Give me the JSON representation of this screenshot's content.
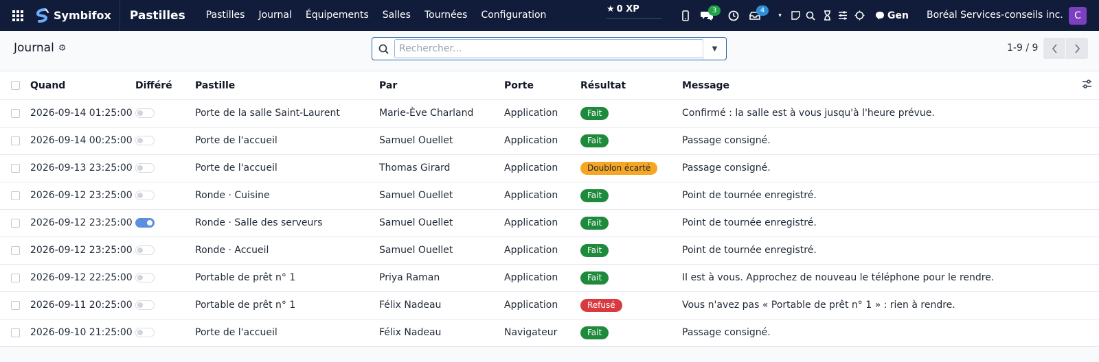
{
  "navbar": {
    "logo_text": "Symbifox",
    "app_title": "Pastilles",
    "menu": [
      "Pastilles",
      "Journal",
      "Équipements",
      "Salles",
      "Tournées",
      "Configuration"
    ],
    "xp_label": "0 XP",
    "messages_badge": "3",
    "activity_badge": "4",
    "gen_label": "Gen",
    "company": "Boréal Services-conseils inc.",
    "avatar_letter": "C"
  },
  "control": {
    "title": "Journal",
    "search_placeholder": "Rechercher...",
    "pager": "1-9 / 9"
  },
  "table": {
    "headers": {
      "when": "Quand",
      "deferred": "Différé",
      "pastille": "Pastille",
      "by": "Par",
      "door": "Porte",
      "result": "Résultat",
      "message": "Message"
    },
    "rows": [
      {
        "when": "2026-09-14 01:25:00",
        "deferred": false,
        "pastille": "Porte de la salle Saint-Laurent",
        "by": "Marie-Ève Charland",
        "door": "Application",
        "result": "Fait",
        "result_kind": "success",
        "message": "Confirmé : la salle est à vous jusqu'à l'heure prévue."
      },
      {
        "when": "2026-09-14 00:25:00",
        "deferred": false,
        "pastille": "Porte de l'accueil",
        "by": "Samuel Ouellet",
        "door": "Application",
        "result": "Fait",
        "result_kind": "success",
        "message": "Passage consigné."
      },
      {
        "when": "2026-09-13 23:25:00",
        "deferred": false,
        "pastille": "Porte de l'accueil",
        "by": "Thomas Girard",
        "door": "Application",
        "result": "Doublon écarté",
        "result_kind": "warning",
        "message": "Passage consigné."
      },
      {
        "when": "2026-09-12 23:25:00",
        "deferred": false,
        "pastille": "Ronde · Cuisine",
        "by": "Samuel Ouellet",
        "door": "Application",
        "result": "Fait",
        "result_kind": "success",
        "message": "Point de tournée enregistré."
      },
      {
        "when": "2026-09-12 23:25:00",
        "deferred": true,
        "pastille": "Ronde · Salle des serveurs",
        "by": "Samuel Ouellet",
        "door": "Application",
        "result": "Fait",
        "result_kind": "success",
        "message": "Point de tournée enregistré."
      },
      {
        "when": "2026-09-12 23:25:00",
        "deferred": false,
        "pastille": "Ronde · Accueil",
        "by": "Samuel Ouellet",
        "door": "Application",
        "result": "Fait",
        "result_kind": "success",
        "message": "Point de tournée enregistré."
      },
      {
        "when": "2026-09-12 22:25:00",
        "deferred": false,
        "pastille": "Portable de prêt n° 1",
        "by": "Priya Raman",
        "door": "Application",
        "result": "Fait",
        "result_kind": "success",
        "message": "Il est à vous. Approchez de nouveau le téléphone pour le rendre."
      },
      {
        "when": "2026-09-11 20:25:00",
        "deferred": false,
        "pastille": "Portable de prêt n° 1",
        "by": "Félix Nadeau",
        "door": "Application",
        "result": "Refusé",
        "result_kind": "danger",
        "message": "Vous n'avez pas « Portable de prêt n° 1 » : rien à rendre."
      },
      {
        "when": "2026-09-10 21:25:00",
        "deferred": false,
        "pastille": "Porte de l'accueil",
        "by": "Félix Nadeau",
        "door": "Navigateur",
        "result": "Fait",
        "result_kind": "success",
        "message": "Passage consigné."
      }
    ]
  }
}
